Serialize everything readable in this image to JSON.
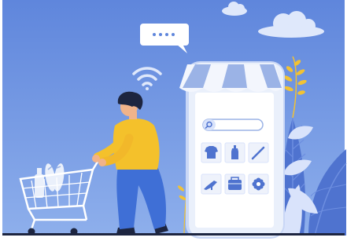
{
  "illustration": {
    "subject": "online-shopping",
    "colors": {
      "sky": "#6b8fdc",
      "sky_top": "#5f86dc",
      "sky_bottom": "#8fb0ec",
      "phone_body": "#eaf0fb",
      "phone_screen": "#ffffff",
      "awning_blue": "#9bb3e6",
      "awning_white": "#f3f6fd",
      "shirt": "#f4c12b",
      "pants": "#3f6fd6",
      "skin": "#f1b38a",
      "hair": "#1d2540",
      "plant_dark": "#4f73cf",
      "plant_light": "#d9e3fb",
      "leaf_yellow": "#f2c233",
      "ground": "#1d2540"
    },
    "icons": [
      "wifi-icon",
      "speech-bubble-icon",
      "search-icon",
      "tshirt-icon",
      "bottle-icon",
      "pen-icon",
      "heel-shoe-icon",
      "bag-icon",
      "flower-icon",
      "shopping-cart-icon",
      "cloud-icon"
    ]
  }
}
